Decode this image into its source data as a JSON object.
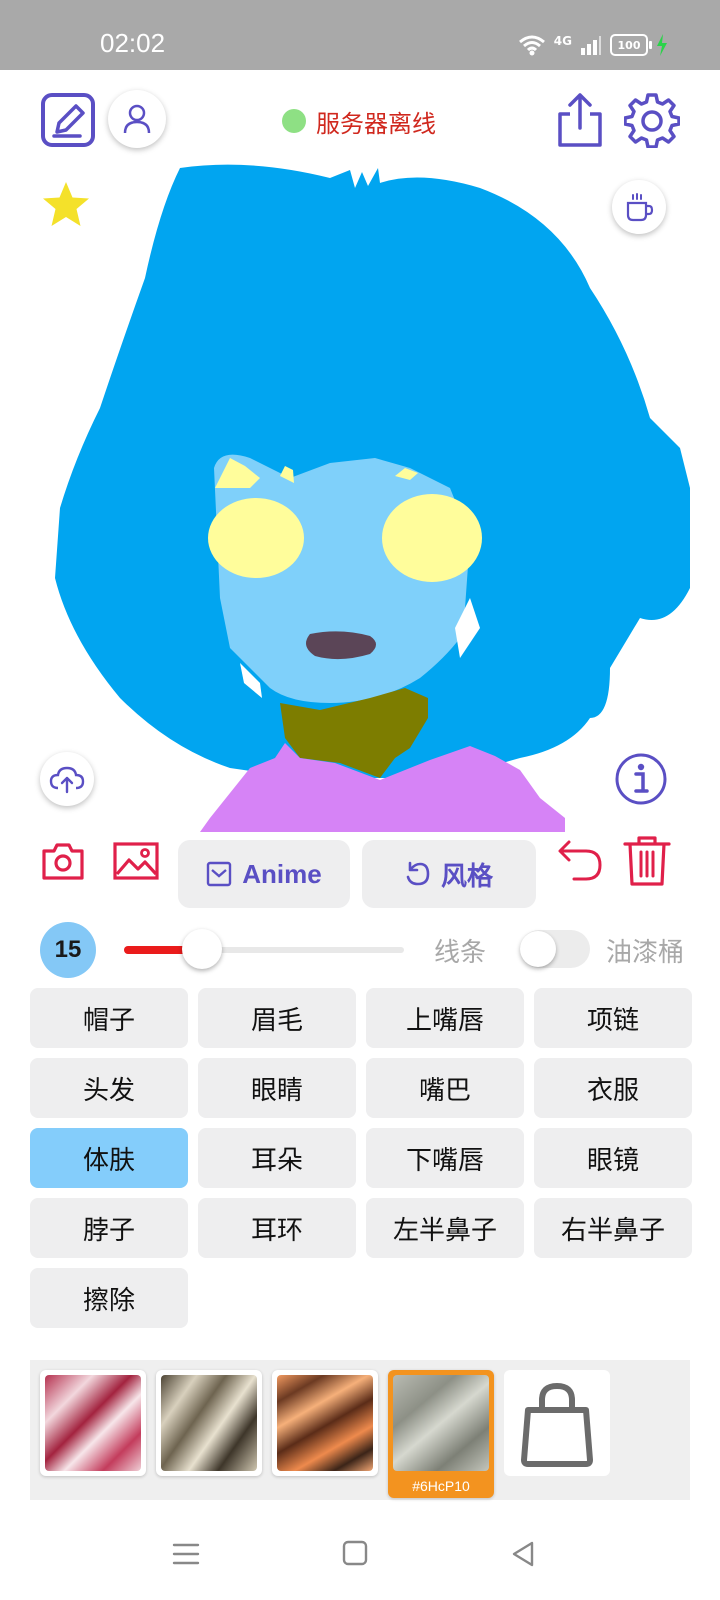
{
  "status_bar": {
    "time": "02:02",
    "network": "4G",
    "battery": "100"
  },
  "server": {
    "status_text": "服务器离线"
  },
  "toolbar": {
    "model_label": "Anime",
    "style_label": "风格"
  },
  "brush": {
    "size": "15",
    "slider_level": 0.28,
    "line_label": "线条",
    "bucket_label": "油漆桶"
  },
  "parts": [
    {
      "label": "帽子"
    },
    {
      "label": "眉毛"
    },
    {
      "label": "上嘴唇"
    },
    {
      "label": "项链"
    },
    {
      "label": "头发"
    },
    {
      "label": "眼睛"
    },
    {
      "label": "嘴巴"
    },
    {
      "label": "衣服"
    },
    {
      "label": "体肤"
    },
    {
      "label": "耳朵"
    },
    {
      "label": "下嘴唇"
    },
    {
      "label": "眼镜"
    },
    {
      "label": "脖子"
    },
    {
      "label": "耳环"
    },
    {
      "label": "左半鼻子"
    },
    {
      "label": "右半鼻子"
    },
    {
      "label": "擦除"
    }
  ],
  "selected_part": "体肤",
  "styles": {
    "selected_code": "#6HcP10"
  },
  "colors": {
    "accent": "#5a4fc4",
    "red": "#e0204a",
    "hair": "#01a5f0",
    "skin": "#7fd0fa",
    "eyes": "#fffd9b",
    "mouth": "#5b4557",
    "neck": "#7d7d00",
    "clothes": "#d683f6",
    "selected_part": "#84cdfb",
    "selected_style": "#f3931f"
  }
}
